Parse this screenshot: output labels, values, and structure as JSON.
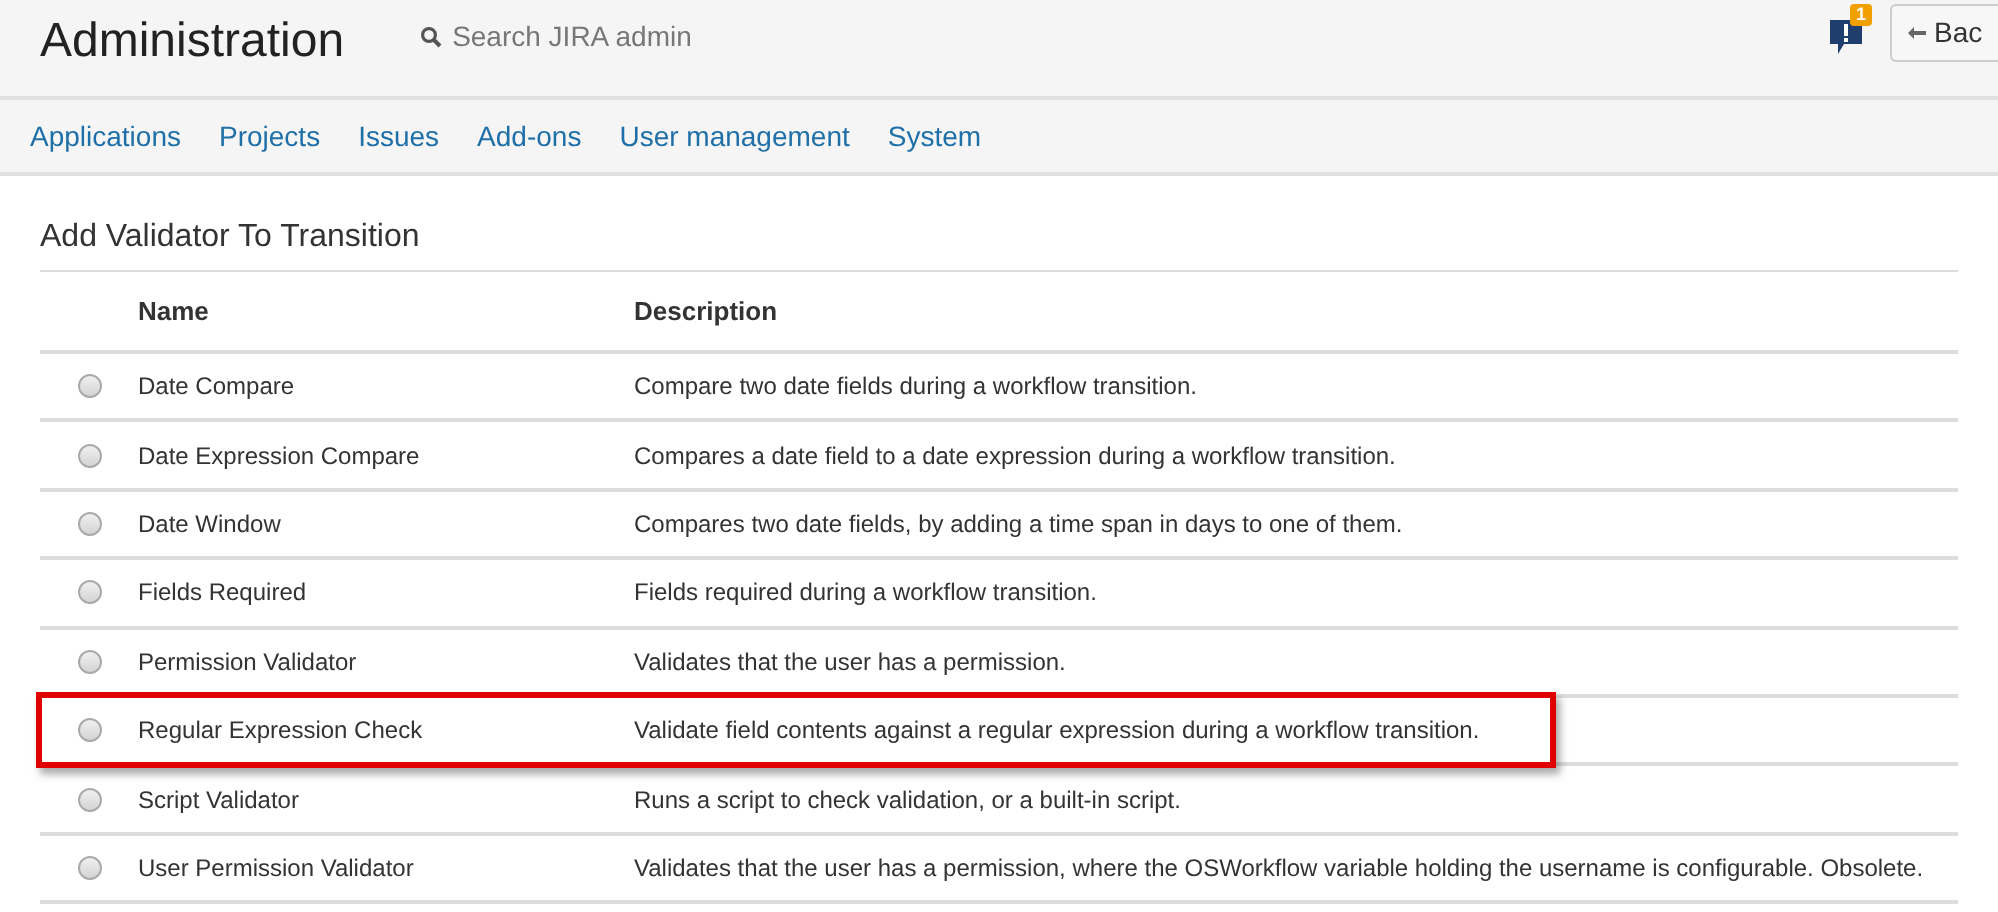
{
  "header": {
    "title": "Administration",
    "search": {
      "placeholder": "Search JIRA admin"
    },
    "notifications": {
      "count": "1"
    },
    "back_button": "Bac"
  },
  "nav": [
    {
      "label": "Applications"
    },
    {
      "label": "Projects"
    },
    {
      "label": "Issues"
    },
    {
      "label": "Add-ons"
    },
    {
      "label": "User management"
    },
    {
      "label": "System"
    }
  ],
  "page_title": "Add Validator To Transition",
  "table": {
    "columns": [
      "Name",
      "Description"
    ],
    "rows": [
      {
        "name": "Date Compare",
        "description": "Compare two date fields during a workflow transition.",
        "selected": false,
        "highlighted": false
      },
      {
        "name": "Date Expression Compare",
        "description": "Compares a date field to a date expression during a workflow transition.",
        "selected": false,
        "highlighted": false
      },
      {
        "name": "Date Window",
        "description": "Compares two date fields, by adding a time span in days to one of them.",
        "selected": false,
        "highlighted": false
      },
      {
        "name": "Fields Required",
        "description": "Fields required during a workflow transition.",
        "selected": false,
        "highlighted": false
      },
      {
        "name": "Permission Validator",
        "description": "Validates that the user has a permission.",
        "selected": false,
        "highlighted": false
      },
      {
        "name": "Regular Expression Check",
        "description": "Validate field contents against a regular expression during a workflow transition.",
        "selected": false,
        "highlighted": true
      },
      {
        "name": "Script Validator",
        "description": "Runs a script to check validation, or a built-in script.",
        "selected": false,
        "highlighted": false
      },
      {
        "name": "User Permission Validator",
        "description": "Validates that the user has a permission, where the OSWorkflow variable holding the username is configurable. Obsolete.",
        "selected": false,
        "highlighted": false
      }
    ]
  }
}
